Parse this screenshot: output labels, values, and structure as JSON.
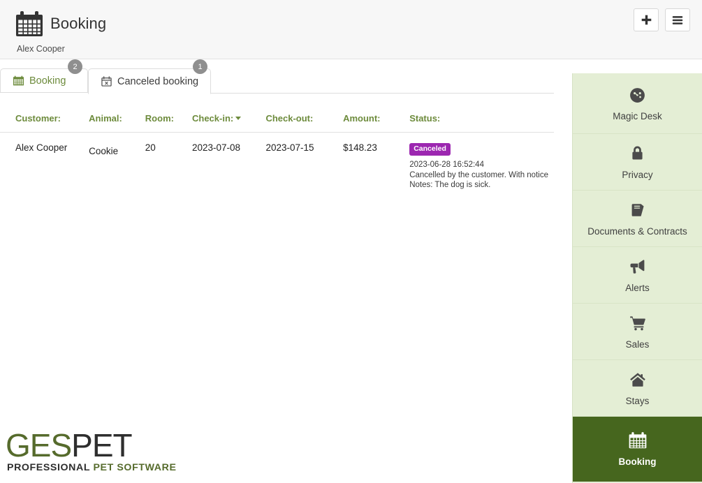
{
  "header": {
    "icon": "calendar-icon",
    "title": "Booking",
    "subtitle": "Alex Cooper",
    "add_button": "+",
    "menu_button": "menu"
  },
  "tabs": [
    {
      "label": "Booking",
      "badge": "2",
      "icon": "calendar-icon",
      "active": false
    },
    {
      "label": "Canceled booking",
      "badge": "1",
      "icon": "calendar-x-icon",
      "active": true
    }
  ],
  "table": {
    "columns": [
      "Customer:",
      "Animal:",
      "Room:",
      "Check-in:",
      "Check-out:",
      "Amount:",
      "Status:"
    ],
    "sorted_column": "Check-in:",
    "sort_direction": "desc",
    "rows": [
      {
        "customer": "Alex Cooper",
        "animal": "Cookie",
        "room": "20",
        "checkin": "2023-07-08",
        "checkout": "2023-07-15",
        "amount": "$148.23",
        "status_badge": "Canceled",
        "status_time": "2023-06-28 16:52:44",
        "status_reason": "Cancelled by the customer. With notice",
        "status_notes": "Notes: The dog is sick."
      }
    ]
  },
  "logo": {
    "part1": "GES",
    "part2": "PET",
    "tagline1": "PROFESSIONAL",
    "tagline2": "PET SOFTWARE"
  },
  "sidebar": {
    "items": [
      {
        "label": "Magic Desk",
        "icon": "dashboard-icon",
        "active": false
      },
      {
        "label": "Privacy",
        "icon": "lock-icon",
        "active": false
      },
      {
        "label": "Documents & Contracts",
        "icon": "book-icon",
        "active": false
      },
      {
        "label": "Alerts",
        "icon": "megaphone-icon",
        "active": false
      },
      {
        "label": "Sales",
        "icon": "cart-icon",
        "active": false
      },
      {
        "label": "Stays",
        "icon": "home-icon",
        "active": false
      },
      {
        "label": "Booking",
        "icon": "calendar-icon",
        "active": true
      }
    ]
  },
  "colors": {
    "accent_green": "#6d8b3c",
    "active_green": "#46661e",
    "sidebar_green": "#e4eed5",
    "status_purple": "#9c27b0",
    "header_bg": "#f7f7f7"
  }
}
